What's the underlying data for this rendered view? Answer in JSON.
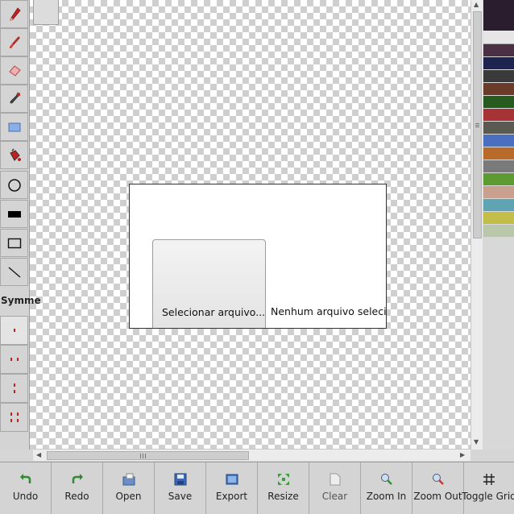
{
  "toolbar": {
    "tools": [
      {
        "name": "pencil-tool",
        "icon": "pencil-icon"
      },
      {
        "name": "brush-tool",
        "icon": "brush-icon"
      },
      {
        "name": "eraser-tool",
        "icon": "eraser-icon"
      },
      {
        "name": "eyedropper-tool",
        "icon": "eyedropper-icon"
      },
      {
        "name": "rectangle-select-tool",
        "icon": "select-rect-icon"
      },
      {
        "name": "fill-bucket-tool",
        "icon": "bucket-icon"
      },
      {
        "name": "ellipse-tool",
        "icon": "ellipse-icon"
      },
      {
        "name": "filled-rectangle-tool",
        "icon": "filled-rect-icon"
      },
      {
        "name": "rectangle-tool",
        "icon": "rect-outline-icon"
      },
      {
        "name": "line-tool",
        "icon": "line-icon"
      }
    ],
    "symmetry_label": "Symme",
    "symmetry_options": [
      "symmetry-none",
      "symmetry-horizontal",
      "symmetry-vertical",
      "symmetry-both"
    ]
  },
  "palette": {
    "colors": [
      "#2a1d2e",
      "#e6e6e6",
      "#4a2f45",
      "#1e2450",
      "#3a3a3a",
      "#6b3b2a",
      "#275a1f",
      "#a83336",
      "#5a5a52",
      "#4b6fbf",
      "#b86a2a",
      "#7a7a7a",
      "#5d9a31",
      "#c9a08e",
      "#5fa4b2",
      "#c3bd4a",
      "#b8c8a8"
    ]
  },
  "bottom_bar": {
    "buttons": [
      {
        "label": "Undo",
        "icon": "undo-icon"
      },
      {
        "label": "Redo",
        "icon": "redo-icon"
      },
      {
        "label": "Open",
        "icon": "open-folder-icon"
      },
      {
        "label": "Save",
        "icon": "save-disk-icon"
      },
      {
        "label": "Export",
        "icon": "export-icon"
      },
      {
        "label": "Resize",
        "icon": "resize-icon"
      },
      {
        "label": "Clear",
        "icon": "clear-page-icon"
      },
      {
        "label": "Zoom In",
        "icon": "zoom-in-icon"
      },
      {
        "label": "Zoom Out",
        "icon": "zoom-out-icon"
      },
      {
        "label": "Toggle Grid",
        "icon": "grid-icon"
      }
    ]
  },
  "dialog": {
    "file_button_label": "Selecionar arquivo...",
    "file_status": "Nenhum arquivo selecionado."
  }
}
